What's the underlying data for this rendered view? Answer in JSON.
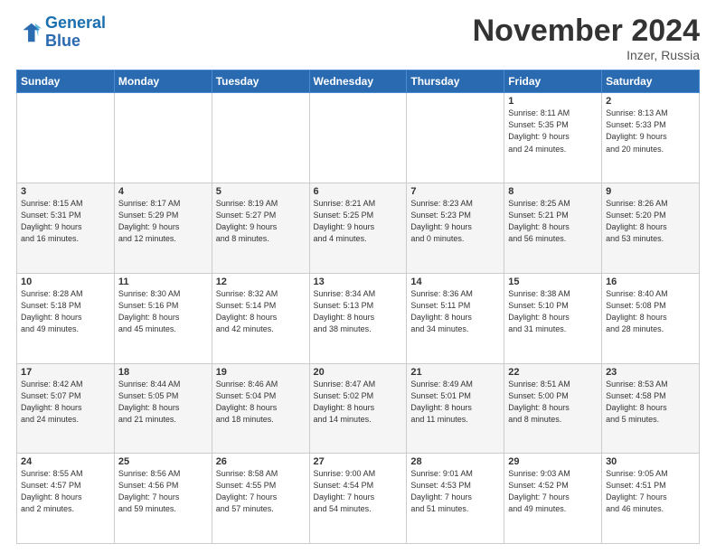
{
  "logo": {
    "line1": "General",
    "line2": "Blue"
  },
  "title": "November 2024",
  "location": "Inzer, Russia",
  "days_header": [
    "Sunday",
    "Monday",
    "Tuesday",
    "Wednesday",
    "Thursday",
    "Friday",
    "Saturday"
  ],
  "weeks": [
    [
      {
        "num": "",
        "info": ""
      },
      {
        "num": "",
        "info": ""
      },
      {
        "num": "",
        "info": ""
      },
      {
        "num": "",
        "info": ""
      },
      {
        "num": "",
        "info": ""
      },
      {
        "num": "1",
        "info": "Sunrise: 8:11 AM\nSunset: 5:35 PM\nDaylight: 9 hours\nand 24 minutes."
      },
      {
        "num": "2",
        "info": "Sunrise: 8:13 AM\nSunset: 5:33 PM\nDaylight: 9 hours\nand 20 minutes."
      }
    ],
    [
      {
        "num": "3",
        "info": "Sunrise: 8:15 AM\nSunset: 5:31 PM\nDaylight: 9 hours\nand 16 minutes."
      },
      {
        "num": "4",
        "info": "Sunrise: 8:17 AM\nSunset: 5:29 PM\nDaylight: 9 hours\nand 12 minutes."
      },
      {
        "num": "5",
        "info": "Sunrise: 8:19 AM\nSunset: 5:27 PM\nDaylight: 9 hours\nand 8 minutes."
      },
      {
        "num": "6",
        "info": "Sunrise: 8:21 AM\nSunset: 5:25 PM\nDaylight: 9 hours\nand 4 minutes."
      },
      {
        "num": "7",
        "info": "Sunrise: 8:23 AM\nSunset: 5:23 PM\nDaylight: 9 hours\nand 0 minutes."
      },
      {
        "num": "8",
        "info": "Sunrise: 8:25 AM\nSunset: 5:21 PM\nDaylight: 8 hours\nand 56 minutes."
      },
      {
        "num": "9",
        "info": "Sunrise: 8:26 AM\nSunset: 5:20 PM\nDaylight: 8 hours\nand 53 minutes."
      }
    ],
    [
      {
        "num": "10",
        "info": "Sunrise: 8:28 AM\nSunset: 5:18 PM\nDaylight: 8 hours\nand 49 minutes."
      },
      {
        "num": "11",
        "info": "Sunrise: 8:30 AM\nSunset: 5:16 PM\nDaylight: 8 hours\nand 45 minutes."
      },
      {
        "num": "12",
        "info": "Sunrise: 8:32 AM\nSunset: 5:14 PM\nDaylight: 8 hours\nand 42 minutes."
      },
      {
        "num": "13",
        "info": "Sunrise: 8:34 AM\nSunset: 5:13 PM\nDaylight: 8 hours\nand 38 minutes."
      },
      {
        "num": "14",
        "info": "Sunrise: 8:36 AM\nSunset: 5:11 PM\nDaylight: 8 hours\nand 34 minutes."
      },
      {
        "num": "15",
        "info": "Sunrise: 8:38 AM\nSunset: 5:10 PM\nDaylight: 8 hours\nand 31 minutes."
      },
      {
        "num": "16",
        "info": "Sunrise: 8:40 AM\nSunset: 5:08 PM\nDaylight: 8 hours\nand 28 minutes."
      }
    ],
    [
      {
        "num": "17",
        "info": "Sunrise: 8:42 AM\nSunset: 5:07 PM\nDaylight: 8 hours\nand 24 minutes."
      },
      {
        "num": "18",
        "info": "Sunrise: 8:44 AM\nSunset: 5:05 PM\nDaylight: 8 hours\nand 21 minutes."
      },
      {
        "num": "19",
        "info": "Sunrise: 8:46 AM\nSunset: 5:04 PM\nDaylight: 8 hours\nand 18 minutes."
      },
      {
        "num": "20",
        "info": "Sunrise: 8:47 AM\nSunset: 5:02 PM\nDaylight: 8 hours\nand 14 minutes."
      },
      {
        "num": "21",
        "info": "Sunrise: 8:49 AM\nSunset: 5:01 PM\nDaylight: 8 hours\nand 11 minutes."
      },
      {
        "num": "22",
        "info": "Sunrise: 8:51 AM\nSunset: 5:00 PM\nDaylight: 8 hours\nand 8 minutes."
      },
      {
        "num": "23",
        "info": "Sunrise: 8:53 AM\nSunset: 4:58 PM\nDaylight: 8 hours\nand 5 minutes."
      }
    ],
    [
      {
        "num": "24",
        "info": "Sunrise: 8:55 AM\nSunset: 4:57 PM\nDaylight: 8 hours\nand 2 minutes."
      },
      {
        "num": "25",
        "info": "Sunrise: 8:56 AM\nSunset: 4:56 PM\nDaylight: 7 hours\nand 59 minutes."
      },
      {
        "num": "26",
        "info": "Sunrise: 8:58 AM\nSunset: 4:55 PM\nDaylight: 7 hours\nand 57 minutes."
      },
      {
        "num": "27",
        "info": "Sunrise: 9:00 AM\nSunset: 4:54 PM\nDaylight: 7 hours\nand 54 minutes."
      },
      {
        "num": "28",
        "info": "Sunrise: 9:01 AM\nSunset: 4:53 PM\nDaylight: 7 hours\nand 51 minutes."
      },
      {
        "num": "29",
        "info": "Sunrise: 9:03 AM\nSunset: 4:52 PM\nDaylight: 7 hours\nand 49 minutes."
      },
      {
        "num": "30",
        "info": "Sunrise: 9:05 AM\nSunset: 4:51 PM\nDaylight: 7 hours\nand 46 minutes."
      }
    ]
  ]
}
